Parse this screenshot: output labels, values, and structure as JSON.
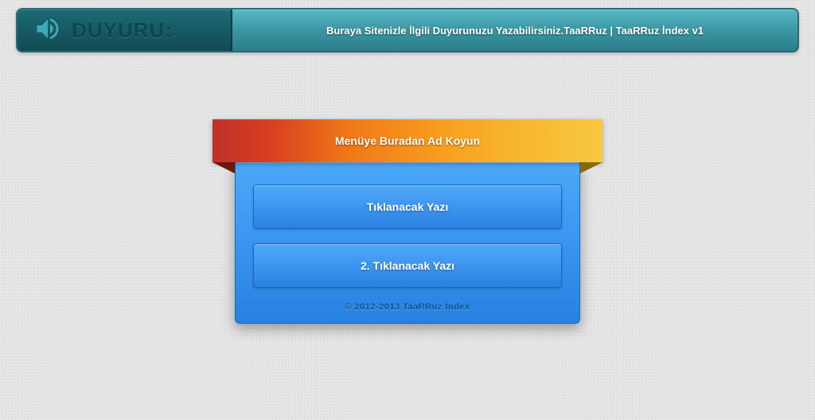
{
  "announcement": {
    "label": "Duyuru:",
    "text": "Buraya Sitenizle İlgili Duyurunuzu Yazabilirsiniz.TaaRRuz | TaaRRuz İndex v1"
  },
  "menu": {
    "title": "Menüye Buradan Ad Koyun",
    "items": [
      {
        "label": "Tıklanacak Yazı"
      },
      {
        "label": "2. Tıklanacak Yazı"
      }
    ]
  },
  "footer": {
    "copyright": "© 2012-2013 TaaRRuz İndex"
  }
}
